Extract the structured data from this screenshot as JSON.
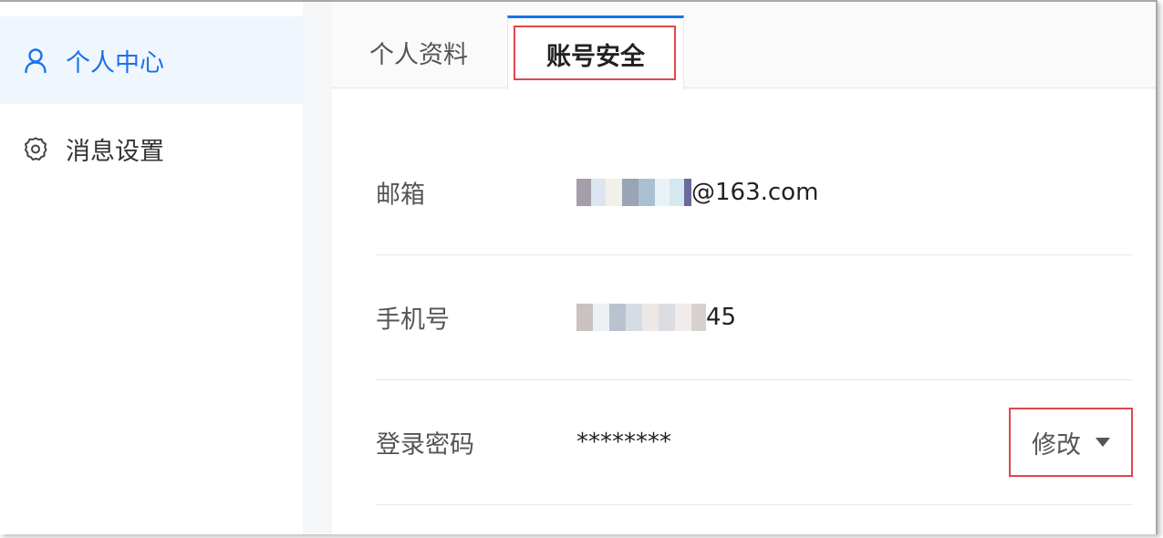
{
  "sidebar": {
    "items": [
      {
        "label": "个人中心",
        "icon": "user-icon",
        "active": true
      },
      {
        "label": "消息设置",
        "icon": "gear-icon",
        "active": false
      }
    ]
  },
  "tabs": [
    {
      "label": "个人资料",
      "active": false
    },
    {
      "label": "账号安全",
      "active": true
    }
  ],
  "security": {
    "email": {
      "label": "邮箱",
      "value_suffix": "@163.com"
    },
    "phone": {
      "label": "手机号",
      "value_suffix": "45"
    },
    "password": {
      "label": "登录密码",
      "value": "********",
      "action_label": "修改"
    }
  },
  "colors": {
    "accent": "#1a73e8",
    "highlight_box": "#e0474c",
    "active_sidebar_bg": "#f0f6fe"
  }
}
